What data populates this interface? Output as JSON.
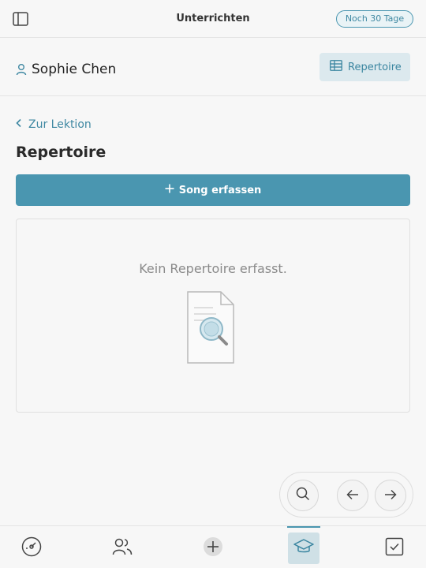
{
  "topbar": {
    "title": "Unterrichten",
    "trial_badge": "Noch 30 Tage"
  },
  "student": {
    "name": "Sophie Chen",
    "tab_label": "Repertoire"
  },
  "content": {
    "back_label": "Zur Lektion",
    "page_title": "Repertoire",
    "add_button_label": "Song erfassen",
    "empty_text": "Kein Repertoire erfasst."
  },
  "icons": {
    "sidebar_toggle": "sidebar-toggle-icon",
    "user": "user-icon",
    "table": "table-icon",
    "chevron_left": "chevron-left-icon",
    "plus": "plus-icon",
    "empty_state": "document-search-icon",
    "search": "search-icon",
    "arrow_left": "arrow-left-icon",
    "arrow_right": "arrow-right-icon",
    "bottom_nav": [
      "dashboard-icon",
      "users-icon",
      "plus-circle-icon",
      "graduation-cap-icon",
      "checkbox-icon"
    ]
  },
  "colors": {
    "accent": "#4a96b0",
    "accent_light": "#dce9ee",
    "background": "#f7f7f7"
  }
}
